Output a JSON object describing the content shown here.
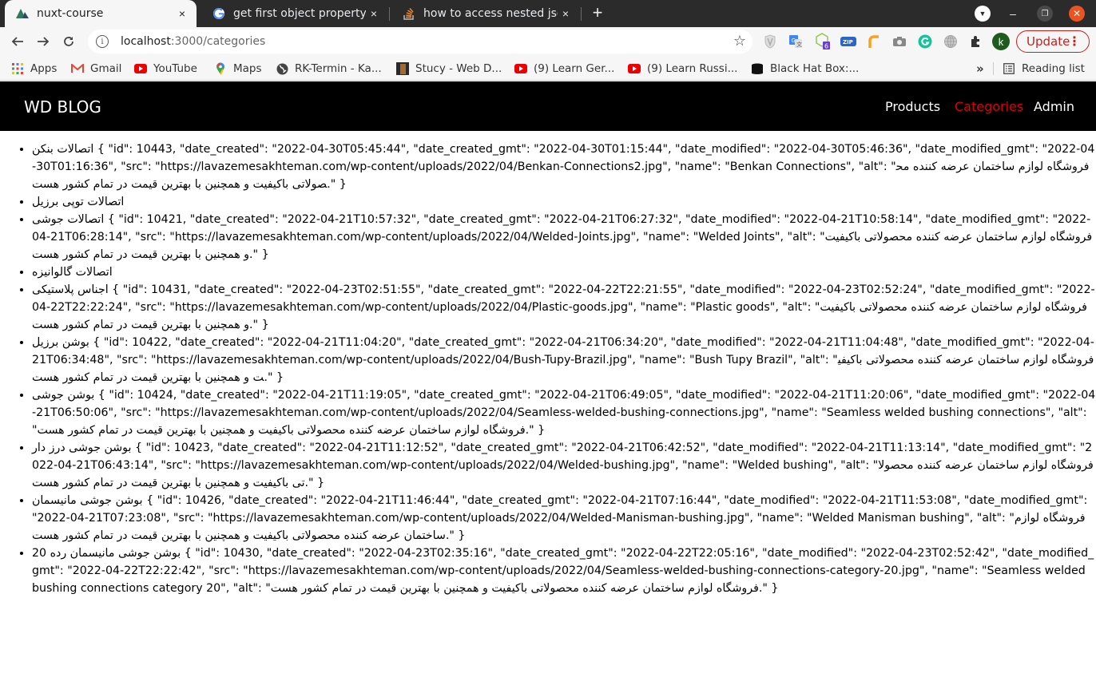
{
  "browser": {
    "tabs": [
      {
        "title": "nuxt-course",
        "icon": "nuxt-icon",
        "active": true
      },
      {
        "title": "get first object property javascript",
        "icon": "google-icon",
        "active": false
      },
      {
        "title": "how to access nested json",
        "icon": "stackoverflow-icon",
        "active": false
      }
    ],
    "new_tab_symbol": "+",
    "close_symbol": "×",
    "url_host": "localhost",
    "url_path": ":3000/categories",
    "update_label": "Update",
    "extension_badge": "6",
    "profile_initial": "k",
    "bookmarks": [
      {
        "label": "Apps",
        "icon": "apps-grid-icon"
      },
      {
        "label": "Gmail",
        "icon": "gmail-icon"
      },
      {
        "label": "YouTube",
        "icon": "youtube-icon"
      },
      {
        "label": "Maps",
        "icon": "maps-icon"
      },
      {
        "label": "RK-Termin - Ka...",
        "icon": "globe-icon"
      },
      {
        "label": "Stucy - Web D...",
        "icon": "stucy-icon"
      },
      {
        "label": "(9) Learn Ger...",
        "icon": "youtube-icon"
      },
      {
        "label": "(9) Learn Russi...",
        "icon": "youtube-icon"
      },
      {
        "label": "Black Hat Box:...",
        "icon": "box-icon"
      }
    ],
    "overflow_symbol": "»",
    "reading_list_label": "Reading list"
  },
  "site": {
    "logo": "WD BLOG",
    "nav": [
      {
        "label": "Products",
        "active": false
      },
      {
        "label": "Categories",
        "active": true
      },
      {
        "label": "Admin",
        "active": false
      }
    ],
    "active_color": "#e00000"
  },
  "categories": [
    {
      "name": "اتصالات بنکن",
      "json": " { \"id\": 10443, \"date_created\": \"2022-04-30T05:45:44\", \"date_created_gmt\": \"2022-04-30T01:15:44\", \"date_modified\": \"2022-04-30T05:46:36\", \"date_modified_gmt\": \"2022-04-30T01:16:36\", \"src\": \"https://lavazemesakhteman.com/wp-content/uploads/2022/04/Benkan-Connections2.jpg\", \"name\": \"Benkan Connections\", \"alt\": \"فروشگاه لوازم ساختمان عرضه کننده محصولاتی باکیفیت و همچنین با بهترین قیمت در تمام کشور هست.\" }"
    },
    {
      "name": "اتصالات توپی برزیل",
      "json": ""
    },
    {
      "name": "اتصالات جوشی",
      "json": " { \"id\": 10421, \"date_created\": \"2022-04-21T10:57:32\", \"date_created_gmt\": \"2022-04-21T06:27:32\", \"date_modified\": \"2022-04-21T10:58:14\", \"date_modified_gmt\": \"2022-04-21T06:28:14\", \"src\": \"https://lavazemesakhteman.com/wp-content/uploads/2022/04/Welded-Joints.jpg\", \"name\": \"Welded Joints\", \"alt\": \"فروشگاه لوازم ساختمان عرضه کننده محصولاتی باکیفیت و همچنین با بهترین قیمت در تمام کشور هست.\" }"
    },
    {
      "name": "اتصالات گالوانیزه",
      "json": ""
    },
    {
      "name": "اجناس پلاستیکی",
      "json": " { \"id\": 10431, \"date_created\": \"2022-04-23T02:51:55\", \"date_created_gmt\": \"2022-04-22T22:21:55\", \"date_modified\": \"2022-04-23T02:52:24\", \"date_modified_gmt\": \"2022-04-22T22:22:24\", \"src\": \"https://lavazemesakhteman.com/wp-content/uploads/2022/04/Plastic-goods.jpg\", \"name\": \"Plastic goods\", \"alt\": \"فروشگاه لوازم ساختمان عرضه کننده محصولاتی باکیفیت و همچنین با بهترین قیمت در تمام کشور هست.\" }"
    },
    {
      "name": "بوشن برزیل",
      "json": " { \"id\": 10422, \"date_created\": \"2022-04-21T11:04:20\", \"date_created_gmt\": \"2022-04-21T06:34:20\", \"date_modified\": \"2022-04-21T11:04:48\", \"date_modified_gmt\": \"2022-04-21T06:34:48\", \"src\": \"https://lavazemesakhteman.com/wp-content/uploads/2022/04/Bush-Tupy-Brazil.jpg\", \"name\": \"Bush Tupy Brazil\", \"alt\": \"فروشگاه لوازم ساختمان عرضه کننده محصولاتی باکیفیت و همچنین با بهترین قیمت در تمام کشور هست.\" }"
    },
    {
      "name": "بوشن جوشی",
      "json": " { \"id\": 10424, \"date_created\": \"2022-04-21T11:19:05\", \"date_created_gmt\": \"2022-04-21T06:49:05\", \"date_modified\": \"2022-04-21T11:20:06\", \"date_modified_gmt\": \"2022-04-21T06:50:06\", \"src\": \"https://lavazemesakhteman.com/wp-content/uploads/2022/04/Seamless-welded-bushing-connections.jpg\", \"name\": \"Seamless welded bushing connections\", \"alt\": \"فروشگاه لوازم ساختمان عرضه کننده محصولاتی باکیفیت و همچنین با بهترین قیمت در تمام کشور هست.\" }"
    },
    {
      "name": "بوشن جوشی درز دار",
      "json": " { \"id\": 10423, \"date_created\": \"2022-04-21T11:12:52\", \"date_created_gmt\": \"2022-04-21T06:42:52\", \"date_modified\": \"2022-04-21T11:13:14\", \"date_modified_gmt\": \"2022-04-21T06:43:14\", \"src\": \"https://lavazemesakhteman.com/wp-content/uploads/2022/04/Welded-bushing.jpg\", \"name\": \"Welded bushing\", \"alt\": \"فروشگاه لوازم ساختمان عرضه کننده محصولاتی باکیفیت و همچنین با بهترین قیمت در تمام کشور هست.\" }"
    },
    {
      "name": "بوشن جوشی مانیسمان",
      "json": " { \"id\": 10426, \"date_created\": \"2022-04-21T11:46:44\", \"date_created_gmt\": \"2022-04-21T07:16:44\", \"date_modified\": \"2022-04-21T11:53:08\", \"date_modified_gmt\": \"2022-04-21T07:23:08\", \"src\": \"https://lavazemesakhteman.com/wp-content/uploads/2022/04/Welded-Manisman-bushing.jpg\", \"name\": \"Welded Manisman bushing\", \"alt\": \"فروشگاه لوازم ساختمان عرضه کننده محصولاتی باکیفیت و همچنین با بهترین قیمت در تمام کشور هست.\" }"
    },
    {
      "name": "بوشن جوشی مانیسمان رده 20",
      "json": " { \"id\": 10430, \"date_created\": \"2022-04-23T02:35:16\", \"date_created_gmt\": \"2022-04-22T22:05:16\", \"date_modified\": \"2022-04-23T02:52:42\", \"date_modified_gmt\": \"2022-04-22T22:22:42\", \"src\": \"https://lavazemesakhteman.com/wp-content/uploads/2022/04/Seamless-welded-bushing-connections-category-20.jpg\", \"name\": \"Seamless welded bushing connections category 20\", \"alt\": \"فروشگاه لوازم ساختمان عرضه کننده محصولاتی باکیفیت و همچنین با بهترین قیمت در تمام کشور هست.\" }"
    }
  ]
}
